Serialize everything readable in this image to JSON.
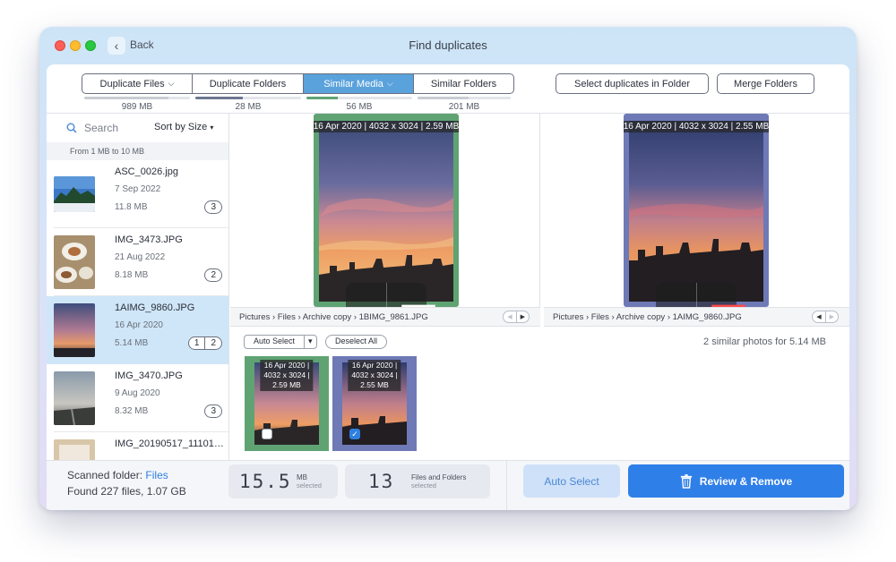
{
  "window": {
    "title": "Find duplicates",
    "back_label": "Back"
  },
  "tabs": [
    {
      "label": "Duplicate Files",
      "size": "989 MB",
      "has_menu": true
    },
    {
      "label": "Duplicate Folders",
      "size": "28 MB"
    },
    {
      "label": "Similar Media",
      "size": "56 MB",
      "has_menu": true,
      "active": true
    },
    {
      "label": "Similar Folders",
      "size": "201 MB"
    }
  ],
  "toolbar": {
    "select_in_folder_label": "Select duplicates in Folder",
    "merge_label": "Merge Folders"
  },
  "sidebar": {
    "search_placeholder": "Search",
    "sort_label": "Sort by Size",
    "range_label": "From 1 MB to 10 MB",
    "items": [
      {
        "name": "ASC_0026.jpg",
        "date": "7 Sep 2022",
        "size": "11.8 MB",
        "count": "3"
      },
      {
        "name": "IMG_3473.JPG",
        "date": "21 Aug 2022",
        "size": "8.18 MB",
        "count": "2"
      },
      {
        "name": "1AIMG_9860.JPG",
        "date": "16 Apr 2020",
        "size": "5.14 MB",
        "count_a": "1",
        "count_b": "2",
        "selected": true
      },
      {
        "name": "IMG_3470.JPG",
        "date": "9 Aug 2020",
        "size": "8.32 MB",
        "count": "3"
      },
      {
        "name": "IMG_20190517_11101…"
      }
    ]
  },
  "preview": {
    "left": {
      "tag": "16 Apr 2020 | 4032 x 3024 | 2.59 MB",
      "path": [
        "Pictures",
        "Files",
        "Archive copy",
        "1BIMG_9861.JPG"
      ]
    },
    "right": {
      "tag": "16 Apr 2020 | 4032 x 3024 | 2.55 MB",
      "path": [
        "Pictures",
        "Files",
        "Archive copy",
        "1AIMG_9860.JPG"
      ]
    },
    "path_sep": "›"
  },
  "gallery": {
    "auto_select_label": "Auto Select",
    "deselect_label": "Deselect All",
    "summary": "2 similar photos for 5.14 MB",
    "items": [
      {
        "line1": "16 Apr 2020 |",
        "line2": "4032 x 3024 |",
        "line3": "2.59 MB",
        "checked": false
      },
      {
        "line1": "16 Apr 2020 |",
        "line2": "4032 x 3024 |",
        "line3": "2.55 MB",
        "checked": true
      }
    ]
  },
  "footer": {
    "scanned_prefix": "Scanned folder:",
    "scanned_folder": "Files",
    "found": "Found 227 files, 1.07 GB",
    "stat_size": {
      "value": "15.5",
      "unit": "MB",
      "sub": "selected"
    },
    "stat_count": {
      "value": "13",
      "unit": "Files and Folders",
      "sub": "selected"
    },
    "auto_select_label": "Auto Select",
    "review_label": "Review & Remove"
  },
  "colors": {
    "accent": "#2f7fe8",
    "keep_frame": "#5fa373",
    "remove_frame": "#6e79b6",
    "active_tab": "#5aa2dc",
    "selected_row": "#cfe6f8"
  },
  "size_bar_fills": [
    0.8,
    0.45,
    0.3,
    0.55
  ]
}
